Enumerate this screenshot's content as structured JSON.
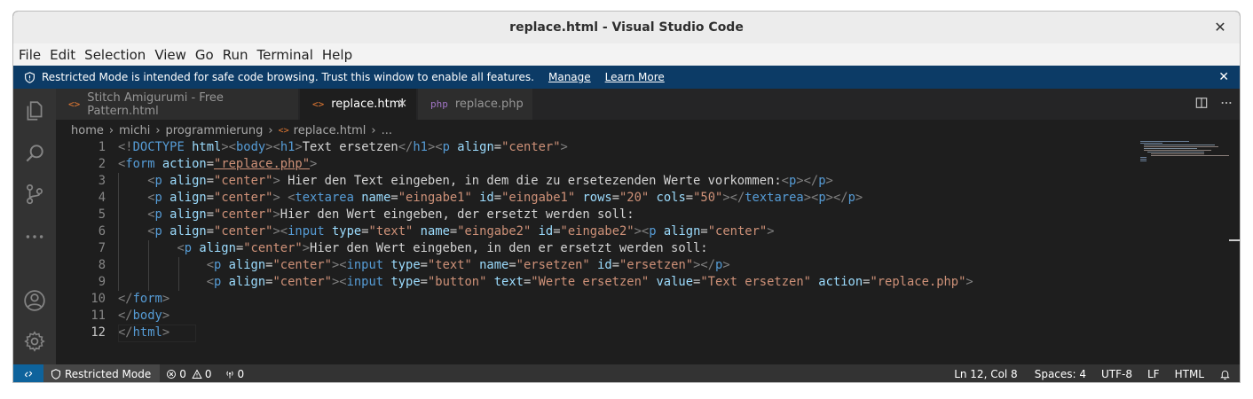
{
  "window": {
    "title": "replace.html - Visual Studio Code",
    "close": "✕"
  },
  "menu": [
    "File",
    "Edit",
    "Selection",
    "View",
    "Go",
    "Run",
    "Terminal",
    "Help"
  ],
  "banner": {
    "text": "Restricted Mode is intended for safe code browsing. Trust this window to enable all features.",
    "manage": "Manage",
    "learn_more": "Learn More",
    "close": "✕"
  },
  "activity_icons": [
    "explorer-icon",
    "search-icon",
    "source-control-icon",
    "more-icon",
    "account-icon",
    "settings-gear-icon"
  ],
  "tabs": [
    {
      "label": "Stitch Amigurumi - Free Pattern.html",
      "icon": "<>",
      "active": false
    },
    {
      "label": "replace.html",
      "icon": "<>",
      "active": true,
      "close": "✕"
    },
    {
      "label": "replace.php",
      "icon": "php",
      "active": false
    }
  ],
  "breadcrumbs": [
    "home",
    "michi",
    "programmierung",
    "replace.html",
    "..."
  ],
  "code_lines": [
    {
      "n": "1",
      "indent": 0
    },
    {
      "n": "2",
      "indent": 0
    },
    {
      "n": "3",
      "indent": 1
    },
    {
      "n": "4",
      "indent": 1
    },
    {
      "n": "5",
      "indent": 1
    },
    {
      "n": "6",
      "indent": 1
    },
    {
      "n": "7",
      "indent": 2
    },
    {
      "n": "8",
      "indent": 3
    },
    {
      "n": "9",
      "indent": 3
    },
    {
      "n": "10",
      "indent": 0
    },
    {
      "n": "11",
      "indent": 0
    },
    {
      "n": "12",
      "indent": 0
    }
  ],
  "status": {
    "restricted": "Restricted Mode",
    "errors": "0",
    "warnings": "0",
    "ports": "0",
    "position": "Ln 12, Col 8",
    "spaces": "Spaces: 4",
    "encoding": "UTF-8",
    "eol": "LF",
    "language": "HTML"
  },
  "colors": {
    "tag": "#569cd6",
    "attr": "#9cdcfe",
    "string": "#ce9178",
    "status_bar": "#333333",
    "banner": "#0c3b66"
  }
}
